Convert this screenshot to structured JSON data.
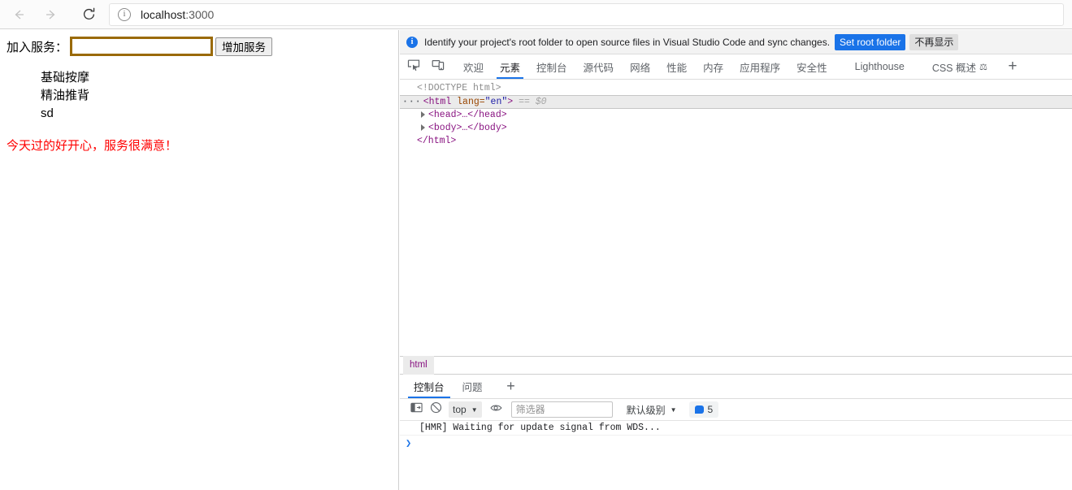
{
  "browser": {
    "back_icon": "arrow-left-icon",
    "forward_icon": "arrow-right-icon",
    "reload_icon": "reload-icon",
    "site_info_icon": "info-circle-icon",
    "url": "localhost:3000",
    "url_host": "localhost",
    "url_port": ":3000"
  },
  "page": {
    "form": {
      "label": "加入服务：",
      "input_value": "",
      "input_placeholder": "",
      "button_label": "增加服务",
      "input_border_color": "#9a6a07"
    },
    "services": [
      "基础按摩",
      "精油推背",
      "sd"
    ],
    "note": {
      "text": "今天过的好开心，服务很满意！",
      "color": "#ff0000"
    }
  },
  "devtools": {
    "notification": {
      "icon": "info-circle-filled-icon",
      "message": "Identify your project's root folder to open source files in Visual Studio Code and sync changes.",
      "primary_button": "Set root folder",
      "secondary_button": "不再显示",
      "primary_color": "#1a73e8"
    },
    "toolbar_icons": [
      {
        "name": "inspect-element-icon"
      },
      {
        "name": "device-toolbar-icon"
      }
    ],
    "tabs": [
      {
        "label": "欢迎",
        "active": false
      },
      {
        "label": "元素",
        "active": true
      },
      {
        "label": "控制台",
        "active": false
      },
      {
        "label": "源代码",
        "active": false
      },
      {
        "label": "网络",
        "active": false
      },
      {
        "label": "性能",
        "active": false
      },
      {
        "label": "内存",
        "active": false
      },
      {
        "label": "应用程序",
        "active": false
      },
      {
        "label": "安全性",
        "active": false
      },
      {
        "label": "Lighthouse",
        "active": false
      },
      {
        "label": "CSS 概述",
        "active": false,
        "experimental": true
      }
    ],
    "add_panel_icon": "plus-icon",
    "dom": {
      "doctype": "<!DOCTYPE html>",
      "ellipsis": "···",
      "html_open_tag": "<html",
      "html_attr_name": "lang",
      "html_attr_value": "\"en\"",
      "html_tag_close": ">",
      "selected_marker": "== $0",
      "head_row": "<head>…</head>",
      "body_row": "<body>…</body>",
      "html_close_tag": "</html>"
    },
    "breadcrumb": [
      "html"
    ],
    "drawer": {
      "tabs": [
        {
          "label": "控制台",
          "active": true
        },
        {
          "label": "问题",
          "active": false
        }
      ],
      "add_icon": "plus-icon",
      "console_toolbar": {
        "sidebar_icon": "console-sidebar-icon",
        "clear_icon": "clear-console-icon",
        "context": "top",
        "eye_icon": "live-expression-icon",
        "filter_placeholder": "筛选器",
        "filter_value": "",
        "level": "默认级别",
        "issues_count": "5",
        "issues_icon": "issue-bubble-icon"
      },
      "messages": [
        "[HMR] Waiting for update signal from WDS..."
      ],
      "prompt_caret": "❯"
    }
  }
}
